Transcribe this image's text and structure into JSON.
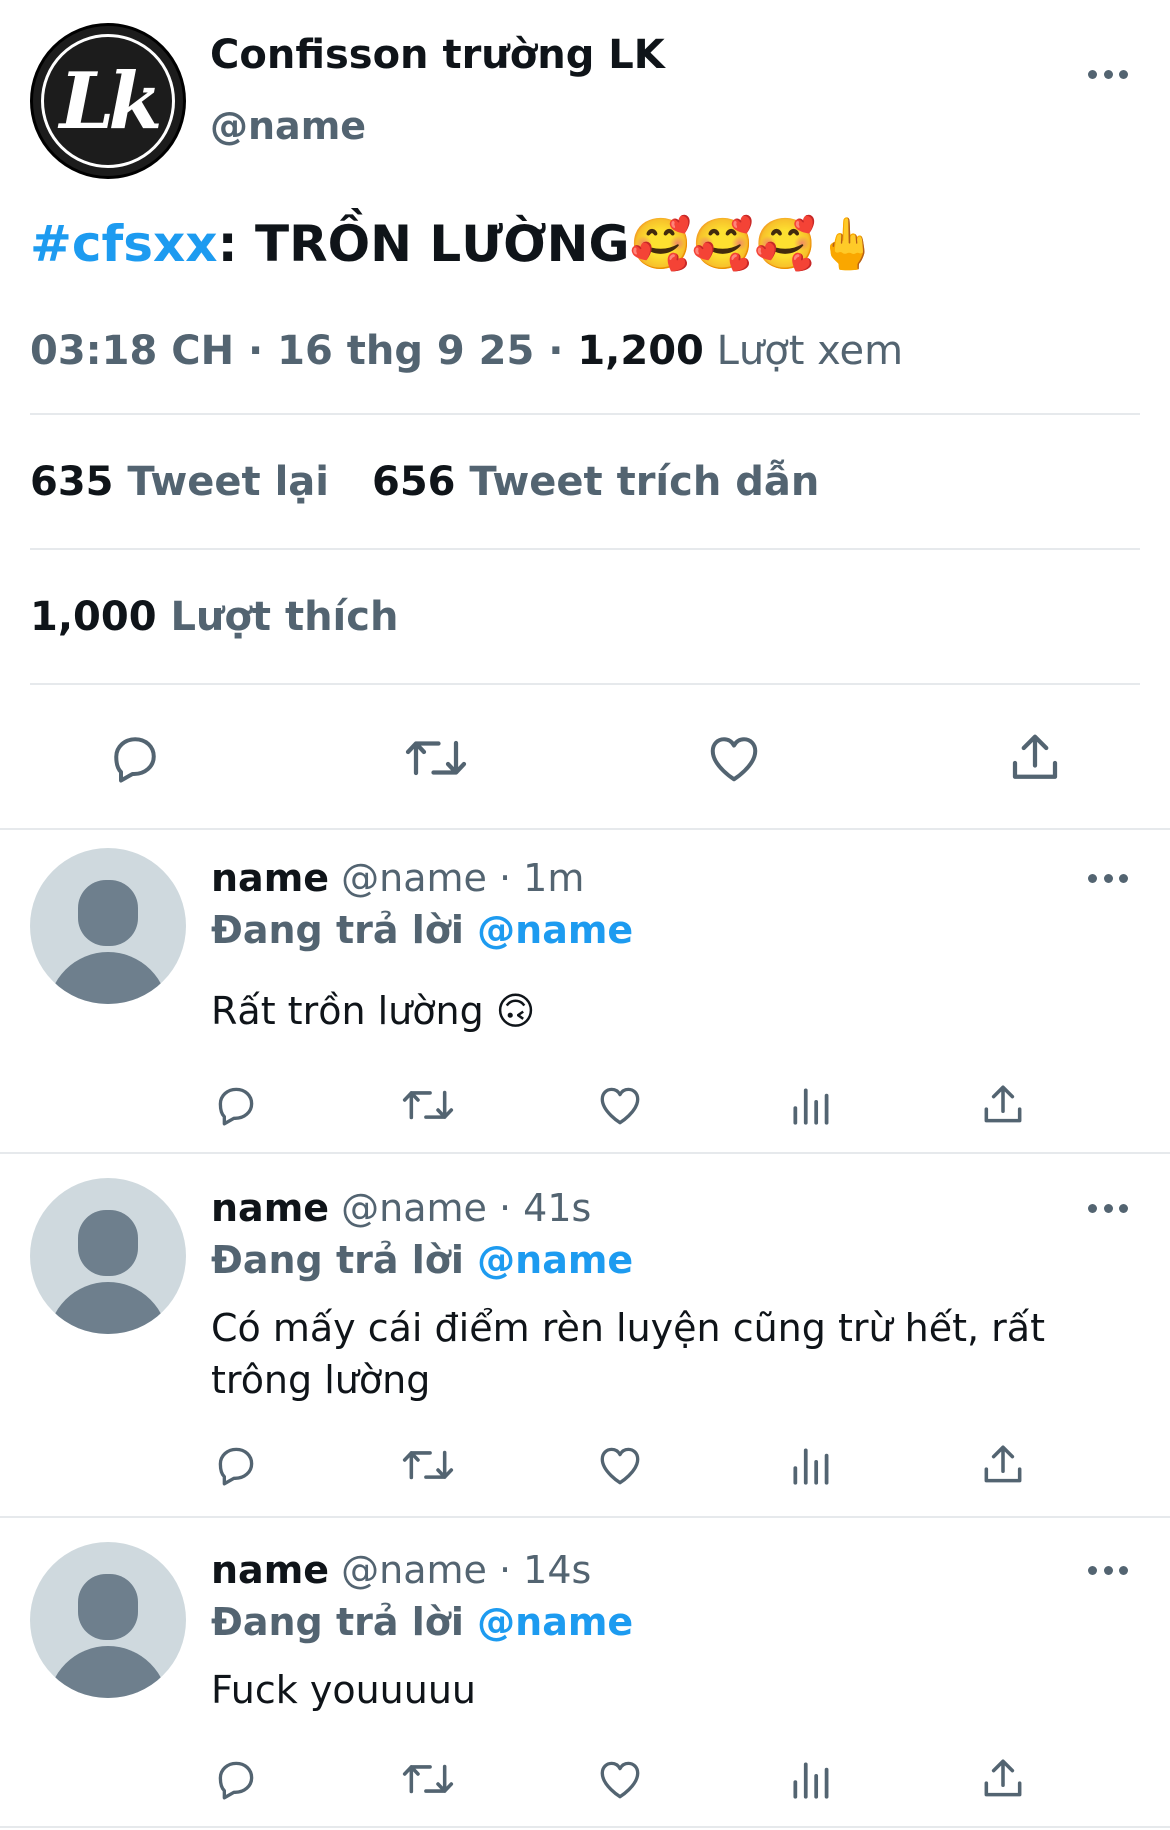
{
  "tweet": {
    "display_name": "Confisson trường LK",
    "handle": "@name",
    "avatar_text": "Lk",
    "hashtag": "#cfsxx",
    "text": ": TRỒN LƯỜNG🥰🥰🥰🖕",
    "time": "03:18 CH · 16 thg 9 25 · ",
    "views": "1,200",
    "views_label": " Lượt xem",
    "retweets_count": "635",
    "retweets_label": " Tweet lại",
    "quotes_count": "656",
    "quotes_label": " Tweet trích dẫn",
    "likes_count": "1,000",
    "likes_label": " Lượt thích"
  },
  "replies": [
    {
      "name": "name",
      "meta": " @name · 1m",
      "replying": "Đang trả lời ",
      "replying_to": "@name",
      "text": "Rất trồn lường 🙃"
    },
    {
      "name": "name",
      "meta": " @name · 41s",
      "replying": "Đang trả lời ",
      "replying_to": "@name",
      "text": "Có mấy cái điểm rèn luyện cũng trừ hết, rất trông lường"
    },
    {
      "name": "name",
      "meta": " @name · 14s",
      "replying": "Đang trả lời ",
      "replying_to": "@name",
      "text": "Fuck youuuuu"
    }
  ],
  "icons": {
    "more": "more-icon",
    "reply": "reply-icon",
    "retweet": "retweet-icon",
    "like": "heart-icon",
    "analytics": "analytics-icon",
    "share": "share-icon"
  },
  "colors": {
    "accent": "#1d9bf0",
    "secondary_text": "#536471",
    "primary_text": "#0f1419",
    "divider": "#e6e9ec"
  }
}
